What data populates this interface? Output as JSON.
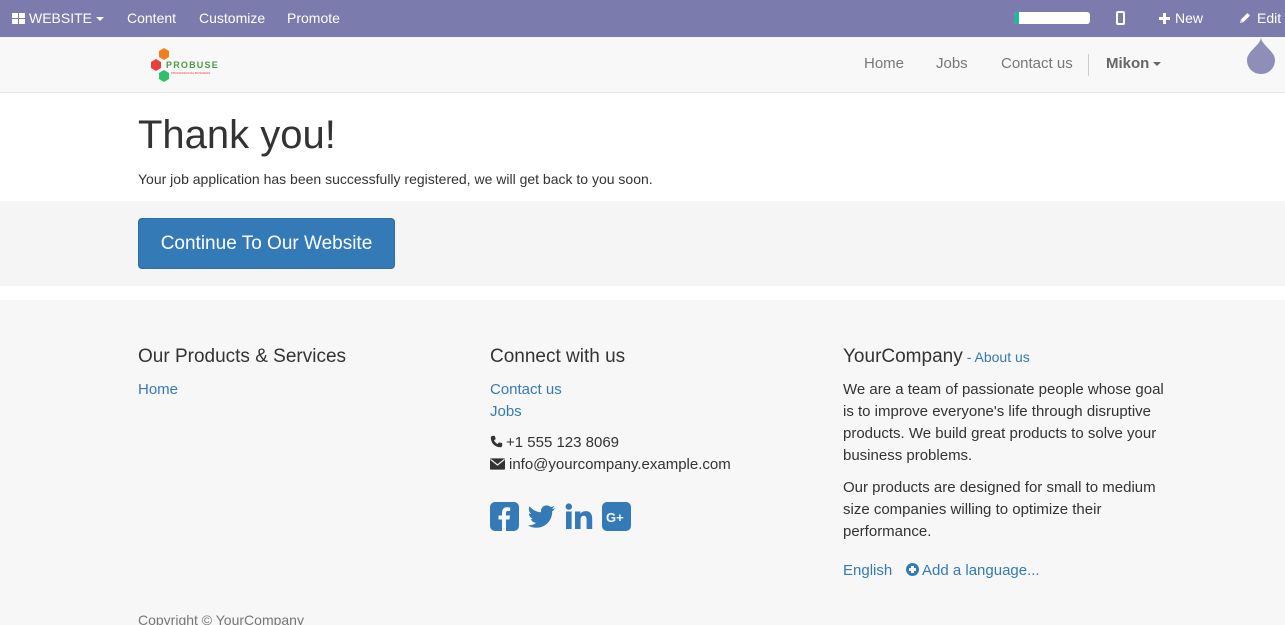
{
  "adminbar": {
    "website_label": "WEBSITE",
    "content_label": "Content",
    "customize_label": "Customize",
    "promote_label": "Promote",
    "progress_fraction": 0.06,
    "new_label": "New",
    "edit_label": "Edit",
    "accent_color": "#7c7bad"
  },
  "navbar": {
    "logo_text": "PROBUSE",
    "logo_tagline": "PROFESSIONAL BUSINESS",
    "links": [
      "Home",
      "Jobs",
      "Contact us"
    ],
    "user_label": "Mikon"
  },
  "main": {
    "title": "Thank you!",
    "message": "Your job application has been successfully registered, we will get back to you soon.",
    "cta_label": "Continue To Our Website",
    "cta_color": "#337ab7"
  },
  "footer": {
    "col1": {
      "heading": "Our Products & Services",
      "links": [
        "Home"
      ]
    },
    "col2": {
      "heading": "Connect with us",
      "links": [
        "Contact us",
        "Jobs"
      ],
      "phone": "+1 555 123 8069",
      "email": "info@yourcompany.example.com",
      "social_icons": [
        "facebook-icon",
        "twitter-icon",
        "linkedin-icon",
        "google-plus-icon"
      ]
    },
    "col3": {
      "company": "YourCompany",
      "about_link": "About us",
      "para1": "We are a team of passionate people whose goal is to improve everyone's life through disruptive products. We build great products to solve your business problems.",
      "para2": "Our products are designed for small to medium size companies willing to optimize their performance.",
      "language": "English",
      "add_language": "Add a language..."
    },
    "copyright": "Copyright © YourCompany"
  }
}
